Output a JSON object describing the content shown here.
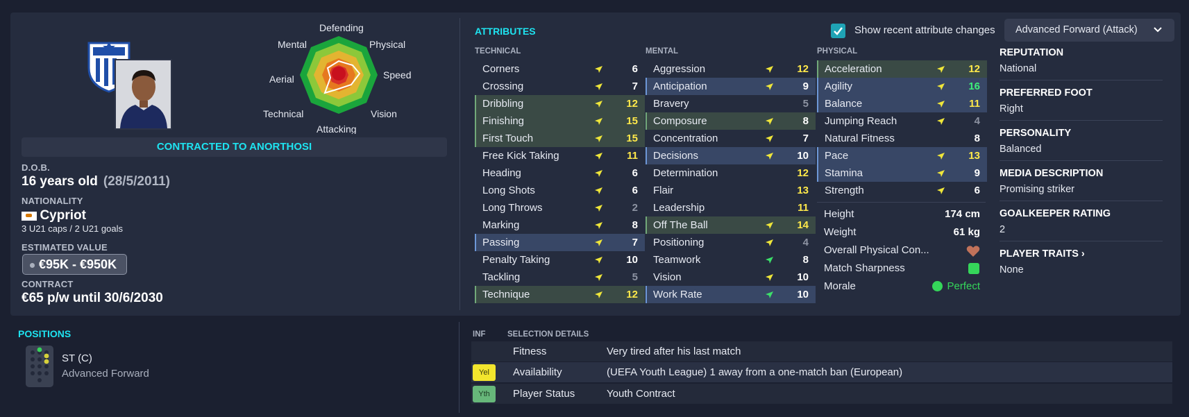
{
  "profile": {
    "contract_banner": "CONTRACTED TO ANORTHOSI",
    "dob_label": "D.O.B.",
    "age": "16 years old",
    "dob": "(28/5/2011)",
    "nationality_label": "NATIONALITY",
    "nationality": "Cypriot",
    "caps": "3 U21 caps / 2 U21 goals",
    "value_label": "ESTIMATED VALUE",
    "value": "€95K - €950K",
    "contract_label": "CONTRACT",
    "contract": "€65 p/w until 30/6/2030"
  },
  "radar": {
    "labels": [
      "Defending",
      "Physical",
      "Speed",
      "Vision",
      "Attacking",
      "Technical",
      "Aerial",
      "Mental"
    ]
  },
  "attributes": {
    "title": "ATTRIBUTES",
    "show_changes_label": "Show recent attribute changes",
    "show_changes_checked": true,
    "role_select": "Advanced Forward (Attack)",
    "technical_label": "TECHNICAL",
    "mental_label": "MENTAL",
    "physical_label": "PHYSICAL",
    "technical": [
      {
        "name": "Corners",
        "value": "6",
        "color": "w",
        "hl": "",
        "arrow": "yellow"
      },
      {
        "name": "Crossing",
        "value": "7",
        "color": "w",
        "hl": "",
        "arrow": "yellow"
      },
      {
        "name": "Dribbling",
        "value": "12",
        "color": "y",
        "hl": "g",
        "arrow": "yellow"
      },
      {
        "name": "Finishing",
        "value": "15",
        "color": "y",
        "hl": "g",
        "arrow": "yellow"
      },
      {
        "name": "First Touch",
        "value": "15",
        "color": "y",
        "hl": "g",
        "arrow": "yellow"
      },
      {
        "name": "Free Kick Taking",
        "value": "11",
        "color": "y",
        "hl": "",
        "arrow": "yellow"
      },
      {
        "name": "Heading",
        "value": "6",
        "color": "w",
        "hl": "",
        "arrow": "yellow"
      },
      {
        "name": "Long Shots",
        "value": "6",
        "color": "w",
        "hl": "",
        "arrow": "yellow"
      },
      {
        "name": "Long Throws",
        "value": "2",
        "color": "d",
        "hl": "",
        "arrow": "yellow"
      },
      {
        "name": "Marking",
        "value": "8",
        "color": "w",
        "hl": "",
        "arrow": "yellow"
      },
      {
        "name": "Passing",
        "value": "7",
        "color": "w",
        "hl": "b",
        "arrow": "yellow"
      },
      {
        "name": "Penalty Taking",
        "value": "10",
        "color": "w",
        "hl": "",
        "arrow": "yellow"
      },
      {
        "name": "Tackling",
        "value": "5",
        "color": "d",
        "hl": "",
        "arrow": "yellow"
      },
      {
        "name": "Technique",
        "value": "12",
        "color": "y",
        "hl": "g",
        "arrow": "yellow"
      }
    ],
    "mental": [
      {
        "name": "Aggression",
        "value": "12",
        "color": "y",
        "hl": "",
        "arrow": "yellow"
      },
      {
        "name": "Anticipation",
        "value": "9",
        "color": "w",
        "hl": "b",
        "arrow": "yellow"
      },
      {
        "name": "Bravery",
        "value": "5",
        "color": "d",
        "hl": "",
        "arrow": "none"
      },
      {
        "name": "Composure",
        "value": "8",
        "color": "w",
        "hl": "g",
        "arrow": "yellow"
      },
      {
        "name": "Concentration",
        "value": "7",
        "color": "w",
        "hl": "",
        "arrow": "yellow"
      },
      {
        "name": "Decisions",
        "value": "10",
        "color": "w",
        "hl": "b",
        "arrow": "yellow"
      },
      {
        "name": "Determination",
        "value": "12",
        "color": "y",
        "hl": "",
        "arrow": "none"
      },
      {
        "name": "Flair",
        "value": "13",
        "color": "y",
        "hl": "",
        "arrow": "none"
      },
      {
        "name": "Leadership",
        "value": "11",
        "color": "y",
        "hl": "",
        "arrow": "none"
      },
      {
        "name": "Off The Ball",
        "value": "14",
        "color": "y",
        "hl": "g",
        "arrow": "yellow"
      },
      {
        "name": "Positioning",
        "value": "4",
        "color": "d",
        "hl": "",
        "arrow": "yellow"
      },
      {
        "name": "Teamwork",
        "value": "8",
        "color": "w",
        "hl": "",
        "arrow": "green"
      },
      {
        "name": "Vision",
        "value": "10",
        "color": "w",
        "hl": "",
        "arrow": "yellow"
      },
      {
        "name": "Work Rate",
        "value": "10",
        "color": "w",
        "hl": "b",
        "arrow": "green"
      }
    ],
    "physical": [
      {
        "name": "Acceleration",
        "value": "12",
        "color": "y",
        "hl": "g",
        "arrow": "yellow"
      },
      {
        "name": "Agility",
        "value": "16",
        "color": "g",
        "hl": "b",
        "arrow": "yellow"
      },
      {
        "name": "Balance",
        "value": "11",
        "color": "y",
        "hl": "b",
        "arrow": "yellow"
      },
      {
        "name": "Jumping Reach",
        "value": "4",
        "color": "d",
        "hl": "",
        "arrow": "yellow"
      },
      {
        "name": "Natural Fitness",
        "value": "8",
        "color": "w",
        "hl": "",
        "arrow": "none"
      },
      {
        "name": "Pace",
        "value": "13",
        "color": "y",
        "hl": "b",
        "arrow": "yellow"
      },
      {
        "name": "Stamina",
        "value": "9",
        "color": "w",
        "hl": "b",
        "arrow": "yellow"
      },
      {
        "name": "Strength",
        "value": "6",
        "color": "w",
        "hl": "",
        "arrow": "yellow"
      }
    ],
    "physical_extra": {
      "height_label": "Height",
      "height": "174 cm",
      "weight_label": "Weight",
      "weight": "61 kg",
      "condition_label": "Overall Physical Con...",
      "sharpness_label": "Match Sharpness",
      "morale_label": "Morale",
      "morale": "Perfect"
    }
  },
  "info": {
    "reputation_label": "REPUTATION",
    "reputation": "National",
    "foot_label": "PREFERRED FOOT",
    "foot": "Right",
    "personality_label": "PERSONALITY",
    "personality": "Balanced",
    "media_label": "MEDIA DESCRIPTION",
    "media": "Promising striker",
    "gk_label": "GOALKEEPER RATING",
    "gk": "2",
    "traits_label": "PLAYER TRAITS",
    "traits": "None"
  },
  "positions": {
    "title": "POSITIONS",
    "position": "ST (C)",
    "role": "Advanced Forward"
  },
  "selection": {
    "inf_label": "INF",
    "details_label": "SELECTION DETAILS",
    "rows": [
      {
        "badge": "",
        "label": "Fitness",
        "value": "Very tired after his last match"
      },
      {
        "badge": "Yel",
        "label": "Availability",
        "value": "(UEFA Youth League) 1 away from a one-match ban (European)"
      },
      {
        "badge": "Yth",
        "label": "Player Status",
        "value": "Youth Contract"
      }
    ]
  },
  "colors": {
    "accent": "#1ee3f0",
    "panel": "#252c3e",
    "background": "#1b2030",
    "highlight_green": "#3a4a45",
    "highlight_blue": "#384766"
  }
}
